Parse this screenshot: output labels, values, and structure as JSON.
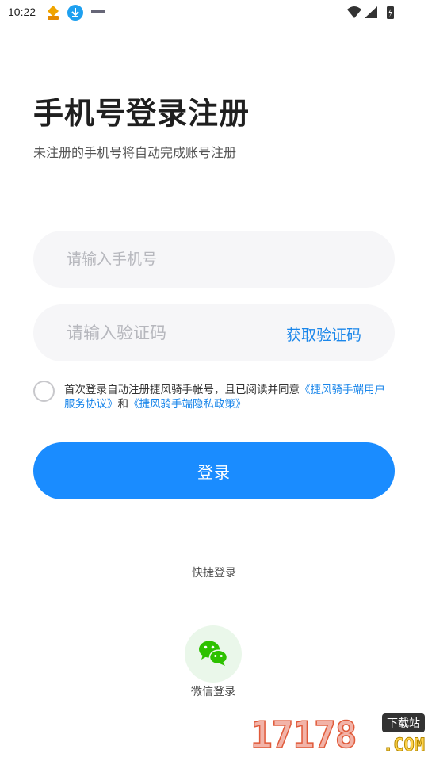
{
  "status_bar": {
    "time": "10:22",
    "left_icons": [
      "app-badge-icon",
      "download-icon",
      "notification-mini-icon"
    ],
    "right_icons": [
      "wifi-icon",
      "signal-icon",
      "battery-charging-icon"
    ]
  },
  "header": {
    "title": "手机号登录注册",
    "subtitle": "未注册的手机号将自动完成账号注册"
  },
  "form": {
    "phone_placeholder": "请输入手机号",
    "code_placeholder": "请输入验证码",
    "get_code_label": "获取验证码"
  },
  "agreement": {
    "checked": false,
    "prefix": "首次登录自动注册捷风骑手帐号，且已阅读并同意",
    "user_agreement_link": "《捷风骑手端用户服务协议》",
    "connector": "和",
    "privacy_link": "《捷风骑手端隐私政策》"
  },
  "login_button_label": "登录",
  "quick_login": {
    "divider_label": "快捷登录",
    "wechat_label": "微信登录",
    "wechat_icon": "wechat-icon"
  },
  "watermark": {
    "number": "17178",
    "badge": "下载站",
    "suffix": ".COM"
  },
  "colors": {
    "accent": "#1a8cff",
    "link": "#1a86ea",
    "field_bg": "#f6f6f8",
    "wechat_green": "#2dc100"
  }
}
